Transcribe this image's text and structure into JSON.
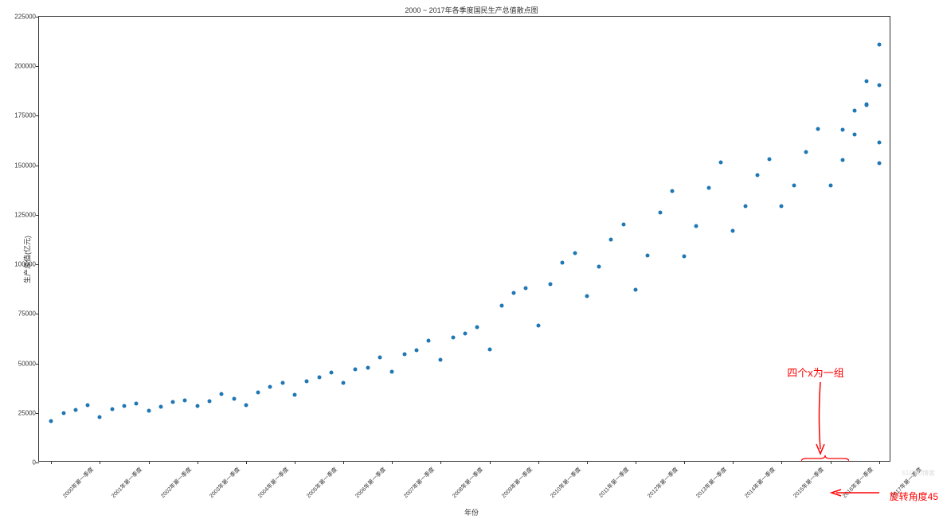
{
  "chart_data": {
    "type": "scatter",
    "title": "2000 ~ 2017年各季度国民生产总值散点图",
    "xlabel": "年份",
    "ylabel": "生产总值(亿元)",
    "ylim": [
      0,
      225000
    ],
    "yticks": [
      0,
      25000,
      50000,
      75000,
      100000,
      125000,
      150000,
      175000,
      200000,
      225000
    ],
    "x_tick_labels": [
      "2000年第一季度",
      "2001年第一季度",
      "2002年第一季度",
      "2003年第一季度",
      "2004年第一季度",
      "2005年第一季度",
      "2006年第一季度",
      "2007年第一季度",
      "2008年第一季度",
      "2009年第一季度",
      "2010年第一季度",
      "2011年第一季度",
      "2012年第一季度",
      "2013年第一季度",
      "2014年第一季度",
      "2015年第一季度",
      "2016年第一季度",
      "2017年第一季度"
    ],
    "x_tick_positions": [
      0,
      4,
      8,
      12,
      16,
      20,
      24,
      28,
      32,
      36,
      40,
      44,
      48,
      52,
      56,
      60,
      64,
      68
    ],
    "x": [
      0,
      1,
      2,
      3,
      4,
      5,
      6,
      7,
      8,
      9,
      10,
      11,
      12,
      13,
      14,
      15,
      16,
      17,
      18,
      19,
      20,
      21,
      22,
      23,
      24,
      25,
      26,
      27,
      28,
      29,
      30,
      31,
      32,
      33,
      34,
      35,
      36,
      37,
      38,
      39,
      40,
      41,
      42,
      43,
      44,
      45,
      46,
      47,
      48,
      49,
      50,
      51,
      52,
      53,
      54,
      55,
      56,
      57,
      58,
      59,
      60,
      61,
      62,
      63,
      64,
      65,
      66,
      67,
      68
    ],
    "values": [
      21000,
      25000,
      26500,
      29000,
      23000,
      27000,
      28500,
      29800,
      26000,
      28000,
      30500,
      31500,
      28500,
      31000,
      34500,
      32000,
      29000,
      35500,
      38000,
      40000,
      34000,
      41000,
      43000,
      45500,
      40000,
      47000,
      48000,
      53000,
      46000,
      54500,
      56500,
      61500,
      52000,
      63000,
      65000,
      68500,
      57000,
      79000,
      85500,
      88000,
      69000,
      90000,
      101000,
      105500,
      84000,
      99000,
      112500,
      120000,
      87000,
      104500,
      126000,
      137000,
      104000,
      119500,
      138500,
      151500,
      117000,
      129500,
      145000,
      153000,
      129500,
      140000,
      156500,
      168500,
      140000,
      152500,
      165500,
      181000,
      151000
    ],
    "extra_points_x": [
      65,
      66,
      67,
      68
    ],
    "extra_points_y": [
      168000,
      177500,
      192500,
      161500
    ],
    "upper_points_x": [
      67,
      68,
      68
    ],
    "upper_points_y": [
      180500,
      190500,
      211000
    ]
  },
  "annotations": {
    "group_label": "四个x为一组",
    "rotate_label": "旋转角度45"
  },
  "watermark": "51CTO博客"
}
